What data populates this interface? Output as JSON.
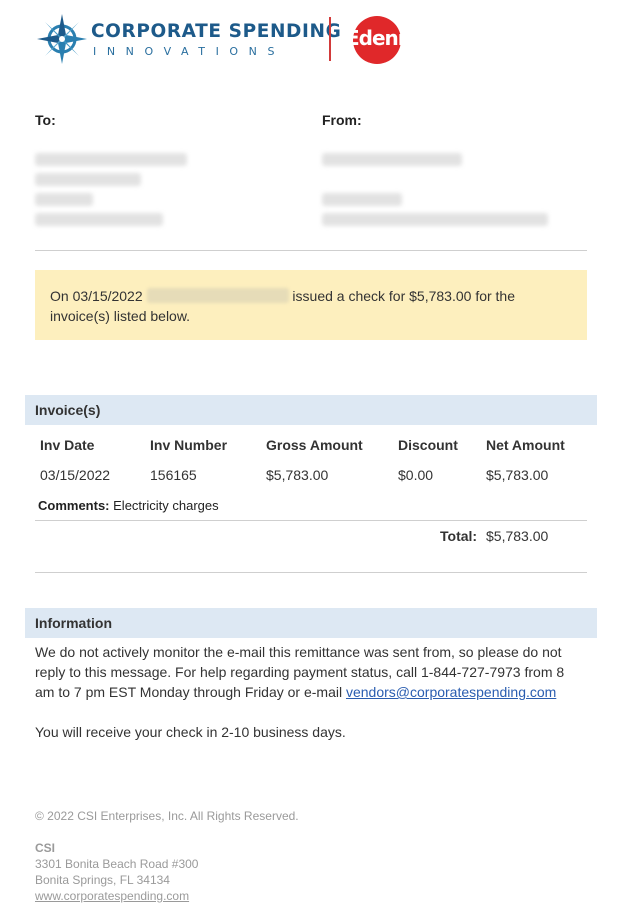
{
  "header": {
    "logo_line1": "CORPORATE SPENDING",
    "logo_line2": "INNOVATIONS",
    "partner_logo": "Edenred",
    "colors": {
      "brand_blue": "#1d5a8a",
      "partner_red": "#e0282a"
    }
  },
  "addresses": {
    "to_label": "To:",
    "from_label": "From:"
  },
  "notice": {
    "prefix": "On 03/15/2022",
    "suffix": "issued a check for $5,783.00 for the invoice(s) listed below.",
    "background": "#fdefbe"
  },
  "invoices": {
    "section_title": "Invoice(s)",
    "columns": [
      "Inv Date",
      "Inv Number",
      "Gross Amount",
      "Discount",
      "Net Amount"
    ],
    "rows": [
      [
        "03/15/2022",
        "156165",
        "$5,783.00",
        "$0.00",
        "$5,783.00"
      ]
    ],
    "comments_label": "Comments:",
    "comments_value": "Electricity charges",
    "total_label": "Total:",
    "total_value": "$5,783.00"
  },
  "information": {
    "section_title": "Information",
    "body_text": "We do not actively monitor the e-mail this remittance was sent from, so please do not reply to this message. For help regarding payment status, call 1-844-727-7973 from 8 am to 7 pm EST Monday through Friday or e-mail",
    "email_link": "vendors@corporatespending.com",
    "delivery_text": "You will receive your check in 2-10 business days."
  },
  "footer": {
    "copyright": "© 2022 CSI Enterprises, Inc. All Rights Reserved.",
    "company": "CSI",
    "address_line1": "3301 Bonita Beach Road #300",
    "address_line2": "Bonita Springs, FL 34134",
    "website": "www.corporatespending.com"
  }
}
